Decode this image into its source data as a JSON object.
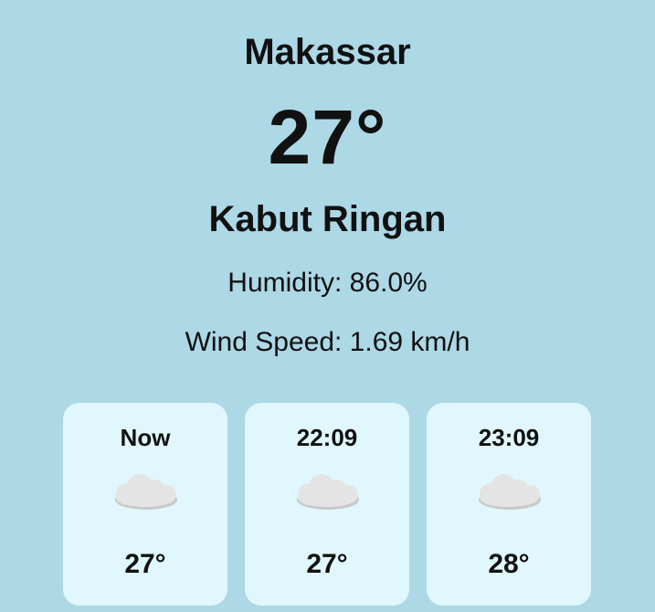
{
  "location": {
    "city": "Makassar"
  },
  "current": {
    "temperature": "27°",
    "condition": "Kabut Ringan",
    "humidity": "Humidity: 86.0%",
    "wind_speed": "Wind Speed: 1.69 km/h"
  },
  "forecast": [
    {
      "time": "Now",
      "icon": "cloud-icon",
      "temperature": "27°"
    },
    {
      "time": "22:09",
      "icon": "cloud-icon",
      "temperature": "27°"
    },
    {
      "time": "23:09",
      "icon": "cloud-icon",
      "temperature": "28°"
    }
  ],
  "colors": {
    "background": "#add8e6",
    "card_background": "#e0f7fd",
    "text": "#111111",
    "cloud": "#e4e4e4"
  }
}
